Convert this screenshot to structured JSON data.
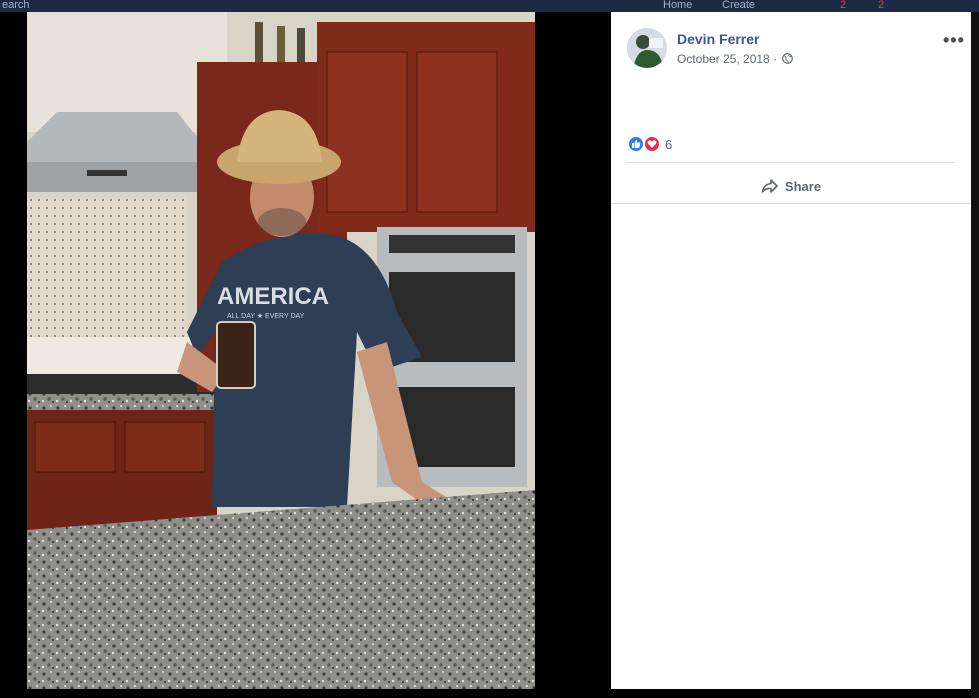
{
  "topbar": {
    "search_fragment": "earch",
    "nav_items": [
      "Home",
      "Create"
    ],
    "badge_counts": [
      "2",
      "2"
    ]
  },
  "post": {
    "author": "Devin Ferrer",
    "date": "October 25, 2018",
    "separator": "·",
    "privacy_icon": "globe-icon",
    "more_label": "•••",
    "reaction_icons": [
      "like-icon",
      "love-icon"
    ],
    "reaction_count": "6",
    "share_label": "Share"
  },
  "photo": {
    "shirt_text": "AMERICA",
    "shirt_subtext": "ALL DAY ★ EVERY DAY"
  },
  "colors": {
    "author_link": "#385898",
    "like_blue": "#2e7cf6",
    "love_red": "#f0284a",
    "panel_bg": "#ffffff",
    "viewer_bg": "#000000"
  }
}
